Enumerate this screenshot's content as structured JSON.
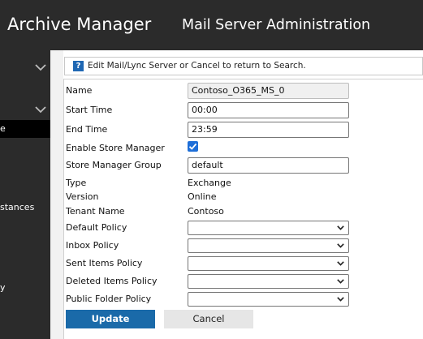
{
  "header": {
    "app_title": "Archive Manager",
    "page_title": "Mail Server Administration"
  },
  "sidebar": {
    "items": [
      {
        "label": "e",
        "active": true
      },
      {
        "label": "stances",
        "active": false
      },
      {
        "label": "y",
        "active": false
      }
    ]
  },
  "info": {
    "icon": "help-icon",
    "icon_glyph": "?",
    "text": "Edit Mail/Lync Server or Cancel to return to Search."
  },
  "form": {
    "name_label": "Name",
    "name_value": "Contoso_O365_MS_0",
    "start_time_label": "Start Time",
    "start_time_value": "00:00",
    "end_time_label": "End Time",
    "end_time_value": "23:59",
    "enable_store_manager_label": "Enable Store Manager",
    "enable_store_manager_checked": true,
    "store_manager_group_label": "Store Manager Group",
    "store_manager_group_value": "default",
    "type_label": "Type",
    "type_value": "Exchange",
    "version_label": "Version",
    "version_value": "Online",
    "tenant_name_label": "Tenant Name",
    "tenant_name_value": "Contoso",
    "default_policy_label": "Default Policy",
    "default_policy_value": "",
    "inbox_policy_label": "Inbox Policy",
    "inbox_policy_value": "",
    "sent_items_policy_label": "Sent Items Policy",
    "sent_items_policy_value": "",
    "deleted_items_policy_label": "Deleted Items Policy",
    "deleted_items_policy_value": "",
    "public_folder_policy_label": "Public Folder Policy",
    "public_folder_policy_value": ""
  },
  "buttons": {
    "update_label": "Update",
    "cancel_label": "Cancel"
  },
  "colors": {
    "header_bg": "#2b2b2b",
    "accent_blue": "#1a6aa9",
    "checkbox_blue": "#1f6fd8"
  }
}
